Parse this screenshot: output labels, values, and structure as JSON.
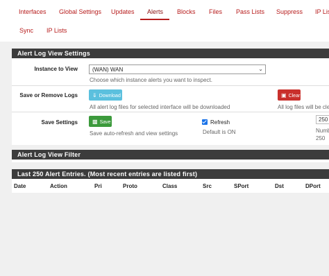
{
  "tabs": [
    {
      "label": "Interfaces"
    },
    {
      "label": "Global Settings"
    },
    {
      "label": "Updates"
    },
    {
      "label": "Alerts"
    },
    {
      "label": "Blocks"
    },
    {
      "label": "Files"
    },
    {
      "label": "Pass Lists"
    },
    {
      "label": "Suppress"
    },
    {
      "label": "IP Lists"
    },
    {
      "label": "Sync"
    },
    {
      "label": "IP Lists"
    }
  ],
  "settings_panel": {
    "title": "Alert Log View Settings",
    "instance": {
      "label": "Instance to View",
      "selected": "(WAN) WAN",
      "help": "Choose which instance alerts you want to inspect."
    },
    "logs": {
      "label": "Save or Remove Logs",
      "download_label": "Download",
      "download_help": "All alert log files for selected interface will be downloaded",
      "clear_label": "Clear",
      "clear_help": "All log files will be cle"
    },
    "save": {
      "label": "Save Settings",
      "save_label": "Save",
      "save_help": "Save auto-refresh and view settings",
      "refresh_label": "Refresh",
      "refresh_help": "Default is ON",
      "count_value": "250",
      "count_help_1": "Numb",
      "count_help_2": "250"
    }
  },
  "filter_panel": {
    "title": "Alert Log View Filter"
  },
  "entries_panel": {
    "title": "Last 250 Alert Entries. (Most recent entries are listed first)",
    "columns": [
      "Date",
      "Action",
      "Pri",
      "Proto",
      "Class",
      "Src",
      "SPort",
      "Dst",
      "DPort"
    ]
  },
  "colors": {
    "accent": "#b71c1c",
    "header_bg": "#3c3c3c"
  }
}
